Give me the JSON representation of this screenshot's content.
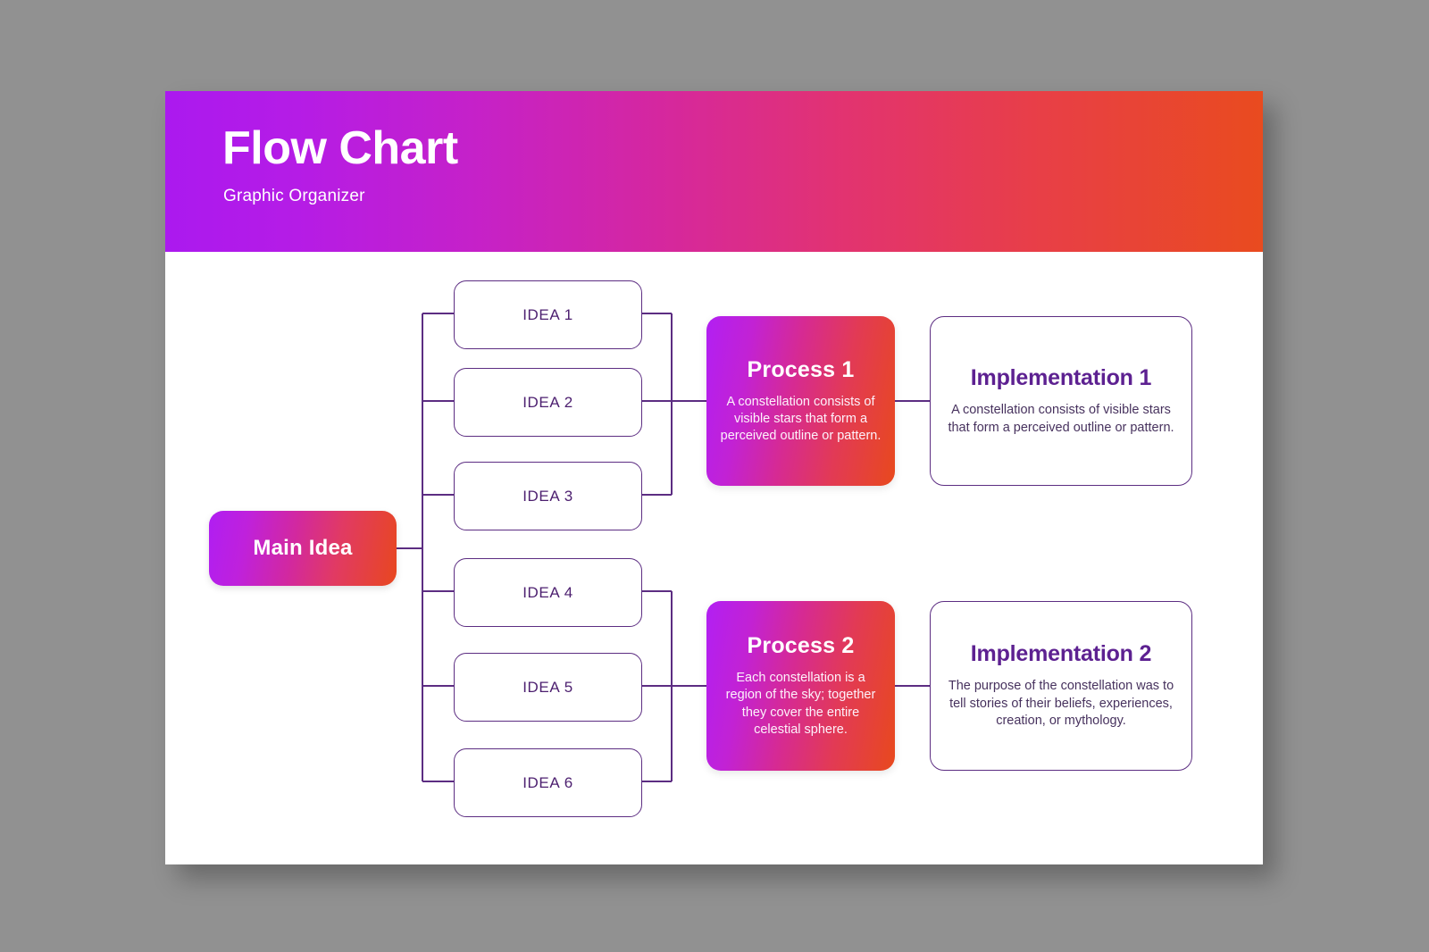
{
  "canvas": {
    "background_color": "#919191",
    "card_background": "#ffffff"
  },
  "header": {
    "title": "Flow Chart",
    "subtitle": "Graphic Organizer",
    "gradient_start": "#ab19ef",
    "gradient_end": "#e94b1f"
  },
  "theme": {
    "outline_color": "#5c2d82",
    "idea_text_color": "#4d2070",
    "impl_title_color": "#5d2191",
    "impl_body_color": "#47325e",
    "node_gradient_start": "#b21ff3",
    "node_gradient_end": "#e8491d"
  },
  "chart_data": {
    "type": "diagram",
    "title": "Flow Chart",
    "subtitle": "Graphic Organizer",
    "root": "Main Idea",
    "branches": [
      "IDEA 1",
      "IDEA 2",
      "IDEA 3",
      "IDEA 4",
      "IDEA 5",
      "IDEA 6"
    ],
    "groups": [
      {
        "ideas": [
          "IDEA 1",
          "IDEA 2",
          "IDEA 3"
        ],
        "process": "Process 1",
        "implementation": "Implementation 1"
      },
      {
        "ideas": [
          "IDEA 4",
          "IDEA 5",
          "IDEA 6"
        ],
        "process": "Process 2",
        "implementation": "Implementation 2"
      }
    ]
  },
  "main_idea": {
    "label": "Main Idea"
  },
  "ideas": [
    {
      "label": "IDEA 1"
    },
    {
      "label": "IDEA 2"
    },
    {
      "label": "IDEA 3"
    },
    {
      "label": "IDEA 4"
    },
    {
      "label": "IDEA 5"
    },
    {
      "label": "IDEA 6"
    }
  ],
  "processes": [
    {
      "title": "Process 1",
      "body": "A constellation consists of visible stars that form a perceived outline or pattern."
    },
    {
      "title": "Process 2",
      "body": "Each constellation is a region of the sky; together they cover the entire celestial sphere."
    }
  ],
  "implementations": [
    {
      "title": "Implementation 1",
      "body": "A constellation consists of visible stars that form a perceived outline or pattern."
    },
    {
      "title": "Implementation 2",
      "body": "The purpose of the constellation was to tell stories of their beliefs, experiences, creation, or mythology."
    }
  ]
}
